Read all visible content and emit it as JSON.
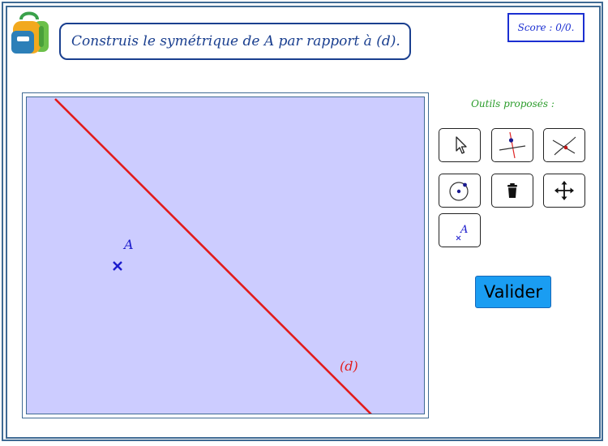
{
  "instruction": "Construis le symétrique de A par rapport à (d).",
  "score": "Score : 0/0.",
  "canvas": {
    "point_label": "A",
    "line_label": "(d)",
    "line_color": "#e31b1b",
    "point_color": "#1a1acc",
    "background": "#ccccff"
  },
  "tools": {
    "title": "Outils proposés :",
    "items": [
      {
        "name": "pointer-tool",
        "icon": "arrow-cursor-icon"
      },
      {
        "name": "perpendicular-tool",
        "icon": "perpendicular-icon"
      },
      {
        "name": "intersection-tool",
        "icon": "intersection-icon"
      },
      {
        "name": "circle-tool",
        "icon": "compass-circle-icon"
      },
      {
        "name": "delete-tool",
        "icon": "trash-icon"
      },
      {
        "name": "move-tool",
        "icon": "move-arrows-icon"
      },
      {
        "name": "label-point-tool",
        "icon": "point-label-icon",
        "label": "A"
      }
    ]
  },
  "validate_label": "Valider",
  "colors": {
    "frame": "#3f6a93",
    "instruction_text": "#1a3f8f",
    "score_border": "#1b2fd1",
    "tools_title": "#2a9c2a",
    "validate_bg": "#1a9df2"
  }
}
